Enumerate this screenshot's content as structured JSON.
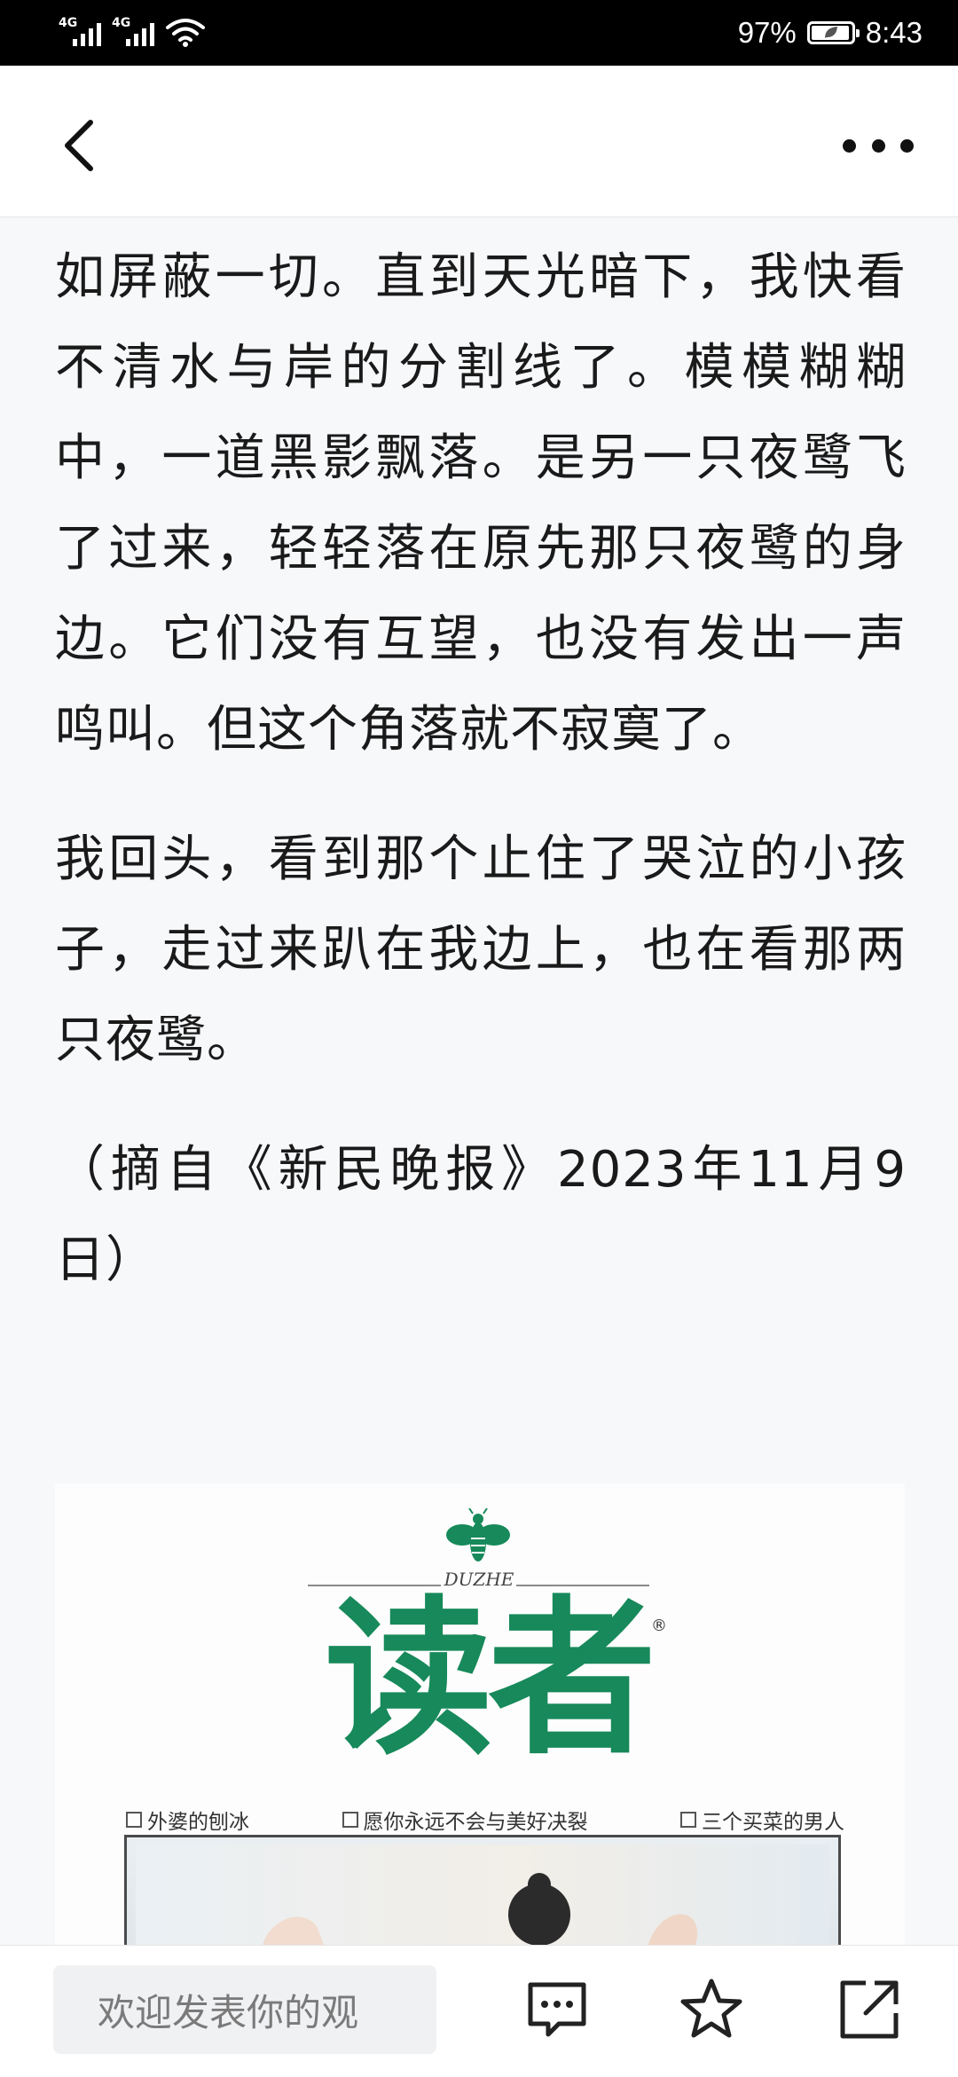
{
  "status_bar": {
    "signal_1_label": "4G",
    "signal_2_label": "4G",
    "battery_percent": "97%",
    "battery_level": 0.97,
    "time": "8:43",
    "icons": [
      "signal-icon",
      "wifi-icon",
      "battery-icon"
    ]
  },
  "nav": {
    "back_icon": "back-chevron-icon",
    "more_icon": "more-dots-icon"
  },
  "article": {
    "paragraphs": [
      "如屏蔽一切。直到天光暗下，我快看不清水与岸的分割线了。模模糊糊中，一道黑影飘落。是另一只夜鹭飞了过来，轻轻落在原先那只夜鹭的身边。它们没有互望，也没有发出一声鸣叫。但这个角落就不寂寞了。",
      "我回头，看到那个止住了哭泣的小孩子，走过来趴在我边上，也在看那两只夜鹭。",
      "（摘自《新民晚报》2023年11月9日）"
    ]
  },
  "magazine_image": {
    "brand_small": "DUZHE",
    "title": "读者",
    "registered_mark": "®",
    "topics": [
      "外婆的刨冰",
      "愿你永远不会与美好决裂",
      "三个买菜的男人"
    ],
    "brand_color": "#17895a"
  },
  "bottom_bar": {
    "comment_placeholder": "欢迎发表你的观",
    "icons": [
      "comment-icon",
      "star-icon",
      "share-icon"
    ]
  }
}
